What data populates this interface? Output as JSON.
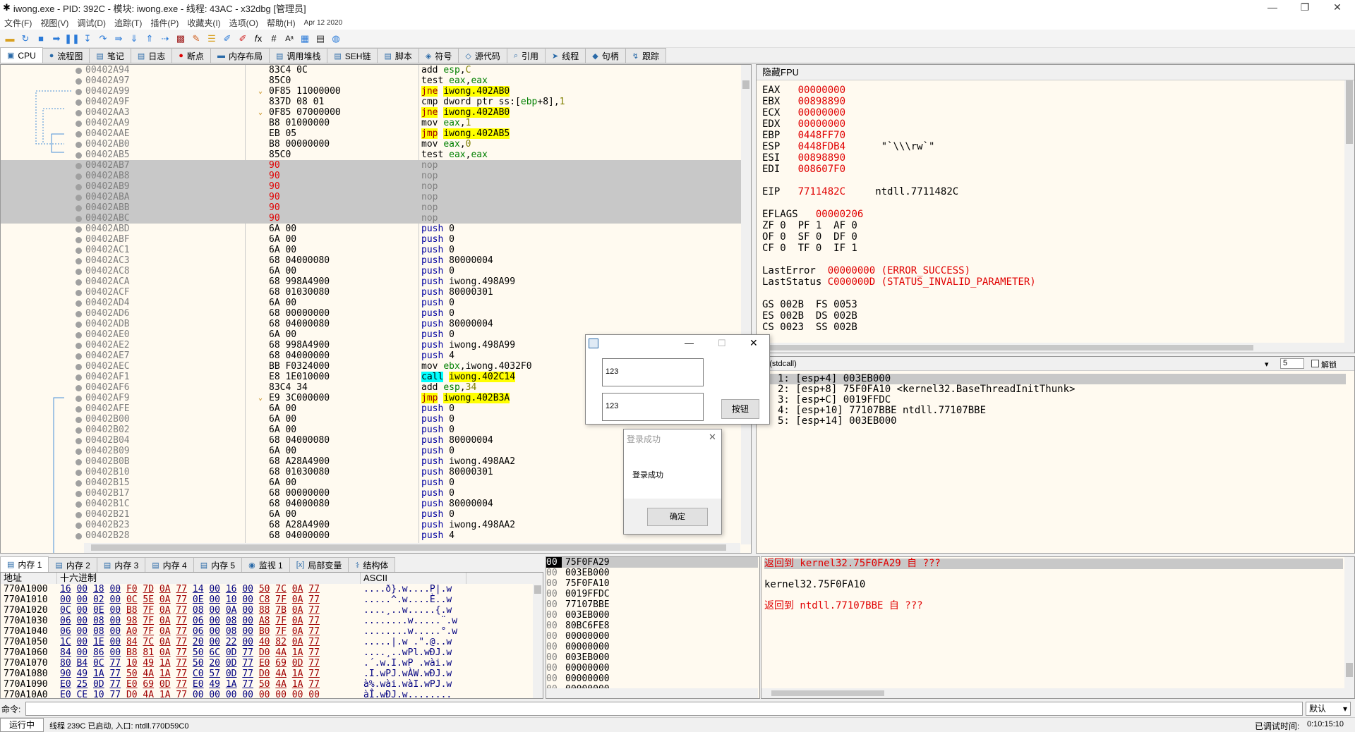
{
  "window": {
    "title": "iwong.exe - PID: 392C - 模块: iwong.exe - 线程: 43AC - x32dbg [管理员]"
  },
  "menu": [
    "文件(F)",
    "视图(V)",
    "调试(D)",
    "追踪(T)",
    "插件(P)",
    "收藏夹(I)",
    "选项(O)",
    "帮助(H)",
    "Apr 12 2020"
  ],
  "tabs": [
    "CPU",
    "流程图",
    "笔记",
    "日志",
    "断点",
    "内存布局",
    "调用堆栈",
    "SEH链",
    "脚本",
    "符号",
    "源代码",
    "引用",
    "线程",
    "句柄",
    "跟踪"
  ],
  "disasm": [
    {
      "addr": "00402A94",
      "bytes": "83C4 0C",
      "ins": "add esp,C"
    },
    {
      "addr": "00402A97",
      "bytes": "85C0",
      "ins": "test eax,eax"
    },
    {
      "addr": "00402A99",
      "bytes": "0F85 11000000",
      "ins": "jne iwong.402AB0",
      "hl": "y"
    },
    {
      "addr": "00402A9F",
      "bytes": "837D 08 01",
      "ins": "cmp dword ptr ss:[ebp+8],1"
    },
    {
      "addr": "00402AA3",
      "bytes": "0F85 07000000",
      "ins": "jne iwong.402AB0",
      "hl": "y"
    },
    {
      "addr": "00402AA9",
      "bytes": "B8 01000000",
      "ins": "mov eax,1"
    },
    {
      "addr": "00402AAE",
      "bytes": "EB 05",
      "ins": "jmp iwong.402AB5",
      "hl": "y"
    },
    {
      "addr": "00402AB0",
      "bytes": "B8 00000000",
      "ins": "mov eax,0"
    },
    {
      "addr": "00402AB5",
      "bytes": "85C0",
      "ins": "test eax,eax"
    },
    {
      "addr": "00402AB7",
      "bytes": "90",
      "ins": "nop",
      "sel": true
    },
    {
      "addr": "00402AB8",
      "bytes": "90",
      "ins": "nop",
      "sel": true
    },
    {
      "addr": "00402AB9",
      "bytes": "90",
      "ins": "nop",
      "sel": true
    },
    {
      "addr": "00402ABA",
      "bytes": "90",
      "ins": "nop",
      "sel": true
    },
    {
      "addr": "00402ABB",
      "bytes": "90",
      "ins": "nop",
      "sel": true
    },
    {
      "addr": "00402ABC",
      "bytes": "90",
      "ins": "nop",
      "sel": true
    },
    {
      "addr": "00402ABD",
      "bytes": "6A 00",
      "ins": "push 0"
    },
    {
      "addr": "00402ABF",
      "bytes": "6A 00",
      "ins": "push 0"
    },
    {
      "addr": "00402AC1",
      "bytes": "6A 00",
      "ins": "push 0"
    },
    {
      "addr": "00402AC3",
      "bytes": "68 04000080",
      "ins": "push 80000004"
    },
    {
      "addr": "00402AC8",
      "bytes": "6A 00",
      "ins": "push 0"
    },
    {
      "addr": "00402ACA",
      "bytes": "68 998A4900",
      "ins": "push iwong.498A99"
    },
    {
      "addr": "00402ACF",
      "bytes": "68 01030080",
      "ins": "push 80000301"
    },
    {
      "addr": "00402AD4",
      "bytes": "6A 00",
      "ins": "push 0"
    },
    {
      "addr": "00402AD6",
      "bytes": "68 00000000",
      "ins": "push 0"
    },
    {
      "addr": "00402ADB",
      "bytes": "68 04000080",
      "ins": "push 80000004"
    },
    {
      "addr": "00402AE0",
      "bytes": "6A 00",
      "ins": "push 0"
    },
    {
      "addr": "00402AE2",
      "bytes": "68 998A4900",
      "ins": "push iwong.498A99"
    },
    {
      "addr": "00402AE7",
      "bytes": "68 04000000",
      "ins": "push 4"
    },
    {
      "addr": "00402AEC",
      "bytes": "BB F0324000",
      "ins": "mov ebx,iwong.4032F0"
    },
    {
      "addr": "00402AF1",
      "bytes": "E8 1E010000",
      "ins": "call iwong.402C14",
      "hl": "c"
    },
    {
      "addr": "00402AF6",
      "bytes": "83C4 34",
      "ins": "add esp,34"
    },
    {
      "addr": "00402AF9",
      "bytes": "E9 3C000000",
      "ins": "jmp iwong.402B3A",
      "hl": "y"
    },
    {
      "addr": "00402AFE",
      "bytes": "6A 00",
      "ins": "push 0"
    },
    {
      "addr": "00402B00",
      "bytes": "6A 00",
      "ins": "push 0"
    },
    {
      "addr": "00402B02",
      "bytes": "6A 00",
      "ins": "push 0"
    },
    {
      "addr": "00402B04",
      "bytes": "68 04000080",
      "ins": "push 80000004"
    },
    {
      "addr": "00402B09",
      "bytes": "6A 00",
      "ins": "push 0"
    },
    {
      "addr": "00402B0B",
      "bytes": "68 A28A4900",
      "ins": "push iwong.498AA2"
    },
    {
      "addr": "00402B10",
      "bytes": "68 01030080",
      "ins": "push 80000301"
    },
    {
      "addr": "00402B15",
      "bytes": "6A 00",
      "ins": "push 0"
    },
    {
      "addr": "00402B17",
      "bytes": "68 00000000",
      "ins": "push 0"
    },
    {
      "addr": "00402B1C",
      "bytes": "68 04000080",
      "ins": "push 80000004"
    },
    {
      "addr": "00402B21",
      "bytes": "6A 00",
      "ins": "push 0"
    },
    {
      "addr": "00402B23",
      "bytes": "68 A28A4900",
      "ins": "push iwong.498AA2"
    },
    {
      "addr": "00402B28",
      "bytes": "68 04000000",
      "ins": "push 4"
    }
  ],
  "regs": {
    "header": "隐藏FPU",
    "lines": [
      [
        "EAX",
        "00000000",
        ""
      ],
      [
        "EBX",
        "00898890",
        ""
      ],
      [
        "ECX",
        "00000000",
        ""
      ],
      [
        "EDX",
        "00000000",
        ""
      ],
      [
        "EBP",
        "0448FF70",
        ""
      ],
      [
        "ESP",
        "0448FDB4",
        "\"`\\\\\\rw`\""
      ],
      [
        "ESI",
        "00898890",
        ""
      ],
      [
        "EDI",
        "008607F0",
        ""
      ]
    ],
    "eip": [
      "EIP",
      "7711482C",
      "ntdll.7711482C"
    ],
    "eflags": [
      "EFLAGS",
      "00000206"
    ],
    "flags": [
      "ZF 0  PF 1  AF 0",
      "OF 0  SF 0  DF 0",
      "CF 0  TF 0  IF 1"
    ],
    "lasterror": [
      "LastError",
      "00000000 (ERROR_SUCCESS)"
    ],
    "laststatus": [
      "LastStatus",
      "C000000D (STATUS_INVALID_PARAMETER)"
    ],
    "seg": [
      "GS 002B  FS 0053",
      "ES 002B  DS 002B",
      "CS 0023  SS 002B"
    ]
  },
  "callconv": "1: (stdcall)",
  "argcount": "5",
  "unlock": "解锁",
  "args": [
    "1: [esp+4] 003EB000",
    "2: [esp+8] 75F0FA10 <kernel32.BaseThreadInitThunk>",
    "3: [esp+C] 0019FFDC",
    "4: [esp+10] 77107BBE ntdll.77107BBE",
    "5: [esp+14] 003EB000"
  ],
  "dialog1": {
    "input1": "123",
    "input2": "123",
    "button": "按钮"
  },
  "dialog2": {
    "title": "登录成功",
    "message": "登录成功",
    "ok": "确定"
  },
  "btabs": [
    "内存 1",
    "内存 2",
    "内存 3",
    "内存 4",
    "内存 5",
    "监视 1",
    "局部变量",
    "结构体"
  ],
  "dumpHeaders": [
    "地址",
    "十六进制",
    "ASCII"
  ],
  "dump": [
    {
      "a": "770A1000",
      "h": "16 00 18 00 F0 7D 0A 77 14 00 16 00 50 7C 0A 77",
      "s": "....ð}.w....P|.w"
    },
    {
      "a": "770A1010",
      "h": "00 00 02 00 0C 5E 0A 77 0E 00 10 00 C8 7F 0A 77",
      "s": ".....^.w....È..w"
    },
    {
      "a": "770A1020",
      "h": "0C 00 0E 00 B8 7F 0A 77 08 00 0A 00 88 7B 0A 77",
      "s": "....¸..w.....{.w"
    },
    {
      "a": "770A1030",
      "h": "06 00 08 00 98 7F 0A 77 06 00 08 00 A8 7F 0A 77",
      "s": "........w.....¨.w"
    },
    {
      "a": "770A1040",
      "h": "06 00 08 00 A0 7F 0A 77 06 00 08 00 B0 7F 0A 77",
      "s": "........w.....°.w"
    },
    {
      "a": "770A1050",
      "h": "1C 00 1E 00 84 7C 0A 77 20 00 22 00 40 82 0A 77",
      "s": ".....|.w .\".@..w"
    },
    {
      "a": "770A1060",
      "h": "84 00 86 00 B8 81 0A 77 50 6C 0D 77 D0 4A 1A 77",
      "s": "....¸..wPl.wÐJ.w"
    },
    {
      "a": "770A1070",
      "h": "80 B4 0C 77 10 49 1A 77 50 20 0D 77 E0 69 0D 77",
      "s": ".´.w.I.wP .wài.w"
    },
    {
      "a": "770A1080",
      "h": "90 49 1A 77 50 4A 1A 77 C0 57 0D 77 D0 4A 1A 77",
      "s": ".I.wPJ.wÀW.wÐJ.w"
    },
    {
      "a": "770A1090",
      "h": "E0 25 0D 77 E0 69 0D 77 E0 49 1A 77 50 4A 1A 77",
      "s": "à%.wài.wàI.wPJ.w"
    },
    {
      "a": "770A10A0",
      "h": "E0 CE 10 77 D0 4A 1A 77 00 00 00 00 00 00 00 00",
      "s": "àÎ.wÐJ.w........"
    }
  ],
  "stack": [
    {
      "o": "00",
      "v": "75F0FA29",
      "cur": true
    },
    {
      "o": "00",
      "v": "003EB000"
    },
    {
      "o": "00",
      "v": "75F0FA10"
    },
    {
      "o": "00",
      "v": "0019FFDC"
    },
    {
      "o": "00",
      "v": "77107BBE"
    },
    {
      "o": "00",
      "v": "003EB000"
    },
    {
      "o": "00",
      "v": "80BC6FE8"
    },
    {
      "o": "00",
      "v": "00000000"
    },
    {
      "o": "00",
      "v": "00000000"
    },
    {
      "o": "00",
      "v": "003EB000"
    },
    {
      "o": "00",
      "v": "00000000"
    },
    {
      "o": "00",
      "v": "00000000"
    },
    {
      "o": "00",
      "v": "00000000"
    }
  ],
  "comments": [
    {
      "t": "返回到 kernel32.75F0FA29 自 ???",
      "red": true
    },
    {
      "t": "kernel32.75F0FA10",
      "red": false
    },
    {
      "t": "返回到 ntdll.77107BBE 自 ???",
      "red": true
    }
  ],
  "cmd": {
    "label": "命令:",
    "value": "",
    "mode": "默认"
  },
  "status": {
    "state": "运行中",
    "msg": "线程 239C 已启动, 入口: ntdll.770D59C0",
    "timelabel": "已调试时间:",
    "time": "0:10:15:10"
  },
  "colors": {
    "yellow": "#ffff00",
    "cyan": "#00ffff",
    "red": "#e00000",
    "gray": "#808080",
    "sel": "#c8c8c8"
  }
}
